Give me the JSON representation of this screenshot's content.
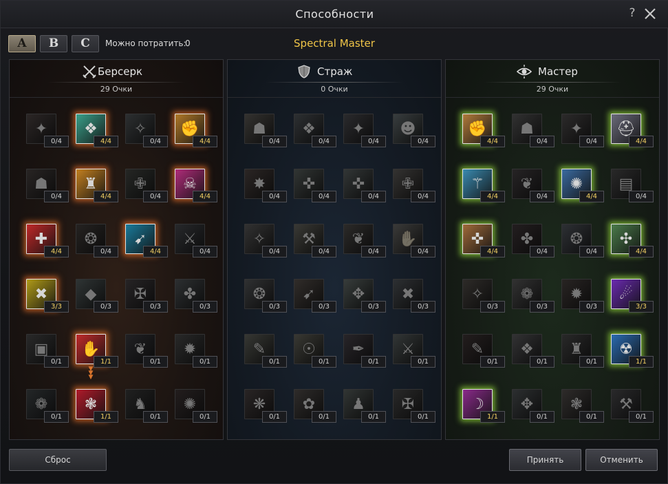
{
  "window": {
    "title": "Способности",
    "help_label": "?"
  },
  "toolbar": {
    "presets": [
      {
        "label": "A",
        "active": true
      },
      {
        "label": "B",
        "active": false
      },
      {
        "label": "C",
        "active": false
      }
    ],
    "points_label": "Можно потратить:",
    "points_value": "0",
    "class_name": "Spectral Master"
  },
  "trees": [
    {
      "key": "berserk",
      "name": "Берсерк",
      "icon": "crossed-swords-icon",
      "points": "29 Очки",
      "accent": "#e06e28",
      "skills": [
        {
          "icon": "skill-icon",
          "glyph": "✦",
          "color": "#7a3a32",
          "level": "0/4",
          "on": false
        },
        {
          "icon": "skill-icon",
          "glyph": "❖",
          "color": "#3aa08a",
          "level": "4/4",
          "on": true
        },
        {
          "icon": "skill-icon",
          "glyph": "✧",
          "color": "#3a5a6a",
          "level": "0/4",
          "on": false
        },
        {
          "icon": "skill-icon",
          "glyph": "✊",
          "color": "#b07828",
          "level": "4/4",
          "on": true
        },
        {
          "icon": "skill-icon",
          "glyph": "☗",
          "color": "#6a3a30",
          "level": "0/4",
          "on": false
        },
        {
          "icon": "skill-icon",
          "glyph": "♜",
          "color": "#c48020",
          "level": "4/4",
          "on": true
        },
        {
          "icon": "skill-icon",
          "glyph": "✙",
          "color": "#3a4a32",
          "level": "0/4",
          "on": false
        },
        {
          "icon": "skill-icon",
          "glyph": "☠",
          "color": "#b02c7a",
          "level": "4/4",
          "on": true
        },
        {
          "icon": "skill-icon",
          "glyph": "✚",
          "color": "#c02828",
          "level": "4/4",
          "on": true
        },
        {
          "icon": "skill-icon",
          "glyph": "❂",
          "color": "#5a3a2a",
          "level": "0/4",
          "on": false
        },
        {
          "icon": "skill-icon",
          "glyph": "➹",
          "color": "#1a7a9a",
          "level": "4/4",
          "on": true
        },
        {
          "icon": "skill-icon",
          "glyph": "⚔",
          "color": "#3a4a6a",
          "level": "0/4",
          "on": false
        },
        {
          "icon": "skill-icon",
          "glyph": "✖",
          "color": "#b09a18",
          "level": "3/3",
          "on": true
        },
        {
          "icon": "skill-icon",
          "glyph": "◆",
          "color": "#2a6a6a",
          "level": "0/3",
          "on": false
        },
        {
          "icon": "skill-icon",
          "glyph": "✠",
          "color": "#5a3a4a",
          "level": "0/3",
          "on": false
        },
        {
          "icon": "skill-icon",
          "glyph": "✤",
          "color": "#3a5a6a",
          "level": "0/3",
          "on": false
        },
        {
          "icon": "skill-icon",
          "glyph": "▣",
          "color": "#4a4a4a",
          "level": "0/1",
          "on": false
        },
        {
          "icon": "skill-icon",
          "glyph": "✋",
          "color": "#c02a2a",
          "level": "1/1",
          "on": true
        },
        {
          "icon": "skill-icon",
          "glyph": "❦",
          "color": "#3a3a5a",
          "level": "0/1",
          "on": false
        },
        {
          "icon": "skill-icon",
          "glyph": "✹",
          "color": "#4a4a4a",
          "level": "0/1",
          "on": false
        },
        {
          "icon": "skill-icon",
          "glyph": "❁",
          "color": "#2a4a5a",
          "level": "0/1",
          "on": false
        },
        {
          "icon": "skill-icon",
          "glyph": "❃",
          "color": "#b01a2a",
          "level": "1/1",
          "on": true
        },
        {
          "icon": "skill-icon",
          "glyph": "♞",
          "color": "#3a3a3a",
          "level": "0/1",
          "on": false
        },
        {
          "icon": "skill-icon",
          "glyph": "✺",
          "color": "#6a2a2a",
          "level": "0/1",
          "on": false
        }
      ]
    },
    {
      "key": "guard",
      "name": "Страж",
      "icon": "shield-icon",
      "points": "0 Очки",
      "accent": "#5a7aa8",
      "skills": [
        {
          "icon": "skill-icon",
          "glyph": "☗",
          "color": "#6a5a3a",
          "level": "0/4",
          "on": false
        },
        {
          "icon": "skill-icon",
          "glyph": "❖",
          "color": "#3a5a7a",
          "level": "0/4",
          "on": false
        },
        {
          "icon": "skill-icon",
          "glyph": "✦",
          "color": "#4a4a6a",
          "level": "0/4",
          "on": false
        },
        {
          "icon": "skill-icon",
          "glyph": "☻",
          "color": "#3a7a8a",
          "level": "0/4",
          "on": false
        },
        {
          "icon": "skill-icon",
          "glyph": "✸",
          "color": "#7a3a2a",
          "level": "0/4",
          "on": false
        },
        {
          "icon": "skill-icon",
          "glyph": "✜",
          "color": "#3a6a5a",
          "level": "0/4",
          "on": false
        },
        {
          "icon": "skill-icon",
          "glyph": "✜",
          "color": "#3a6a6a",
          "level": "0/4",
          "on": false
        },
        {
          "icon": "skill-icon",
          "glyph": "✙",
          "color": "#6a5a4a",
          "level": "0/4",
          "on": false
        },
        {
          "icon": "skill-icon",
          "glyph": "✧",
          "color": "#5a5a5a",
          "level": "0/4",
          "on": false
        },
        {
          "icon": "skill-icon",
          "glyph": "⚒",
          "color": "#6a6a3a",
          "level": "0/4",
          "on": false
        },
        {
          "icon": "skill-icon",
          "glyph": "❦",
          "color": "#5a4a3a",
          "level": "0/4",
          "on": false
        },
        {
          "icon": "skill-icon",
          "glyph": "✋",
          "color": "#6a6a5a",
          "level": "0/4",
          "on": false
        },
        {
          "icon": "skill-icon",
          "glyph": "❂",
          "color": "#4a5a6a",
          "level": "0/3",
          "on": false
        },
        {
          "icon": "skill-icon",
          "glyph": "➹",
          "color": "#7a4a2a",
          "level": "0/3",
          "on": false
        },
        {
          "icon": "skill-icon",
          "glyph": "✥",
          "color": "#3a7a6a",
          "level": "0/3",
          "on": false
        },
        {
          "icon": "skill-icon",
          "glyph": "✖",
          "color": "#3a5a7a",
          "level": "0/3",
          "on": false
        },
        {
          "icon": "skill-icon",
          "glyph": "✎",
          "color": "#5a6a3a",
          "level": "0/1",
          "on": false
        },
        {
          "icon": "skill-icon",
          "glyph": "☉",
          "color": "#6a6a2a",
          "level": "0/1",
          "on": false
        },
        {
          "icon": "skill-icon",
          "glyph": "✒",
          "color": "#5a3a6a",
          "level": "0/1",
          "on": false
        },
        {
          "icon": "skill-icon",
          "glyph": "⚔",
          "color": "#3a6a6a",
          "level": "0/1",
          "on": false
        },
        {
          "icon": "skill-icon",
          "glyph": "❋",
          "color": "#6a3a3a",
          "level": "0/1",
          "on": false
        },
        {
          "icon": "skill-icon",
          "glyph": "✿",
          "color": "#6a4a3a",
          "level": "0/1",
          "on": false
        },
        {
          "icon": "skill-icon",
          "glyph": "♟",
          "color": "#3a6a5a",
          "level": "0/1",
          "on": false
        },
        {
          "icon": "skill-icon",
          "glyph": "✠",
          "color": "#4a4a4a",
          "level": "0/1",
          "on": false
        }
      ]
    },
    {
      "key": "master",
      "name": "Мастер",
      "icon": "eye-icon",
      "points": "29 Очки",
      "accent": "#96dc3c",
      "skills": [
        {
          "icon": "skill-icon",
          "glyph": "✊",
          "color": "#b07a3a",
          "level": "4/4",
          "on": true
        },
        {
          "icon": "skill-icon",
          "glyph": "☗",
          "color": "#5a5a5a",
          "level": "0/4",
          "on": false
        },
        {
          "icon": "skill-icon",
          "glyph": "✦",
          "color": "#5a4a4a",
          "level": "0/4",
          "on": false
        },
        {
          "icon": "skill-icon",
          "glyph": "⛑",
          "color": "#6a6a7a",
          "level": "4/4",
          "on": true
        },
        {
          "icon": "skill-icon",
          "glyph": "⚚",
          "color": "#3a8ab0",
          "level": "4/4",
          "on": true
        },
        {
          "icon": "skill-icon",
          "glyph": "❦",
          "color": "#5a3a4a",
          "level": "0/4",
          "on": false
        },
        {
          "icon": "skill-icon",
          "glyph": "✺",
          "color": "#3a6aa0",
          "level": "4/4",
          "on": true
        },
        {
          "icon": "skill-icon",
          "glyph": "▤",
          "color": "#4a4a4a",
          "level": "0/4",
          "on": false
        },
        {
          "icon": "skill-icon",
          "glyph": "✜",
          "color": "#a06a3a",
          "level": "4/4",
          "on": true
        },
        {
          "icon": "skill-icon",
          "glyph": "✤",
          "color": "#6a2a3a",
          "level": "0/4",
          "on": false
        },
        {
          "icon": "skill-icon",
          "glyph": "❂",
          "color": "#3a5a8a",
          "level": "0/4",
          "on": false
        },
        {
          "icon": "skill-icon",
          "glyph": "✣",
          "color": "#4a7a4a",
          "level": "4/4",
          "on": true
        },
        {
          "icon": "skill-icon",
          "glyph": "✧",
          "color": "#6a4a2a",
          "level": "0/3",
          "on": false
        },
        {
          "icon": "skill-icon",
          "glyph": "❁",
          "color": "#5a5a5a",
          "level": "0/3",
          "on": false
        },
        {
          "icon": "skill-icon",
          "glyph": "✹",
          "color": "#6a3a2a",
          "level": "0/3",
          "on": false
        },
        {
          "icon": "skill-icon",
          "glyph": "☄",
          "color": "#6a2ab0",
          "level": "3/3",
          "on": true
        },
        {
          "icon": "skill-icon",
          "glyph": "✎",
          "color": "#6a2a2a",
          "level": "0/1",
          "on": false
        },
        {
          "icon": "skill-icon",
          "glyph": "❖",
          "color": "#5a5a6a",
          "level": "0/1",
          "on": false
        },
        {
          "icon": "skill-icon",
          "glyph": "♜",
          "color": "#4a4a4a",
          "level": "0/1",
          "on": false
        },
        {
          "icon": "skill-icon",
          "glyph": "☢",
          "color": "#2a6ab0",
          "level": "1/1",
          "on": true
        },
        {
          "icon": "skill-icon",
          "glyph": "☽",
          "color": "#8a2a8a",
          "level": "1/1",
          "on": true
        },
        {
          "icon": "skill-icon",
          "glyph": "✥",
          "color": "#3a5a6a",
          "level": "0/1",
          "on": false
        },
        {
          "icon": "skill-icon",
          "glyph": "❃",
          "color": "#6a4a3a",
          "level": "0/1",
          "on": false
        },
        {
          "icon": "skill-icon",
          "glyph": "⚒",
          "color": "#4a4a5a",
          "level": "0/1",
          "on": false
        }
      ]
    }
  ],
  "footer": {
    "reset_label": "Сброс",
    "accept_label": "Принять",
    "cancel_label": "Отменить"
  }
}
